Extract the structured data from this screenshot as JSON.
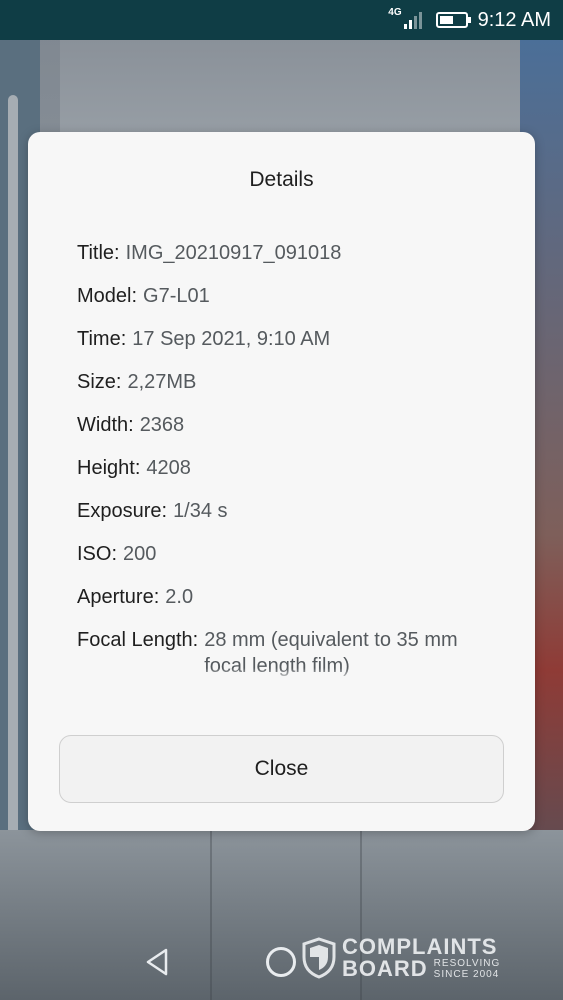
{
  "status_bar": {
    "network": "4G",
    "time": "9:12 AM",
    "signal_level": 2,
    "battery_level": 0.55
  },
  "dialog": {
    "title": "Details",
    "fields": [
      {
        "label": "Title:",
        "value": "IMG_20210917_091018"
      },
      {
        "label": "Model:",
        "value": "G7-L01"
      },
      {
        "label": "Time:",
        "value": "17 Sep 2021, 9:10 AM"
      },
      {
        "label": "Size:",
        "value": "2,27MB"
      },
      {
        "label": "Width:",
        "value": "2368"
      },
      {
        "label": "Height:",
        "value": "4208"
      },
      {
        "label": "Exposure:",
        "value": "1/34 s"
      },
      {
        "label": "ISO:",
        "value": "200"
      },
      {
        "label": "Aperture:",
        "value": "2.0"
      },
      {
        "label": "Focal Length:",
        "value": "28 mm (equivalent to 35 mm focal length film)"
      }
    ],
    "close_label": "Close"
  },
  "nav": {
    "back_icon": "back-triangle-icon",
    "home_icon": "home-circle-icon"
  },
  "watermark": {
    "line1": "COMPLAINTS",
    "line2": "BOARD",
    "sub1": "RESOLVING",
    "sub2": "SINCE 2004"
  }
}
